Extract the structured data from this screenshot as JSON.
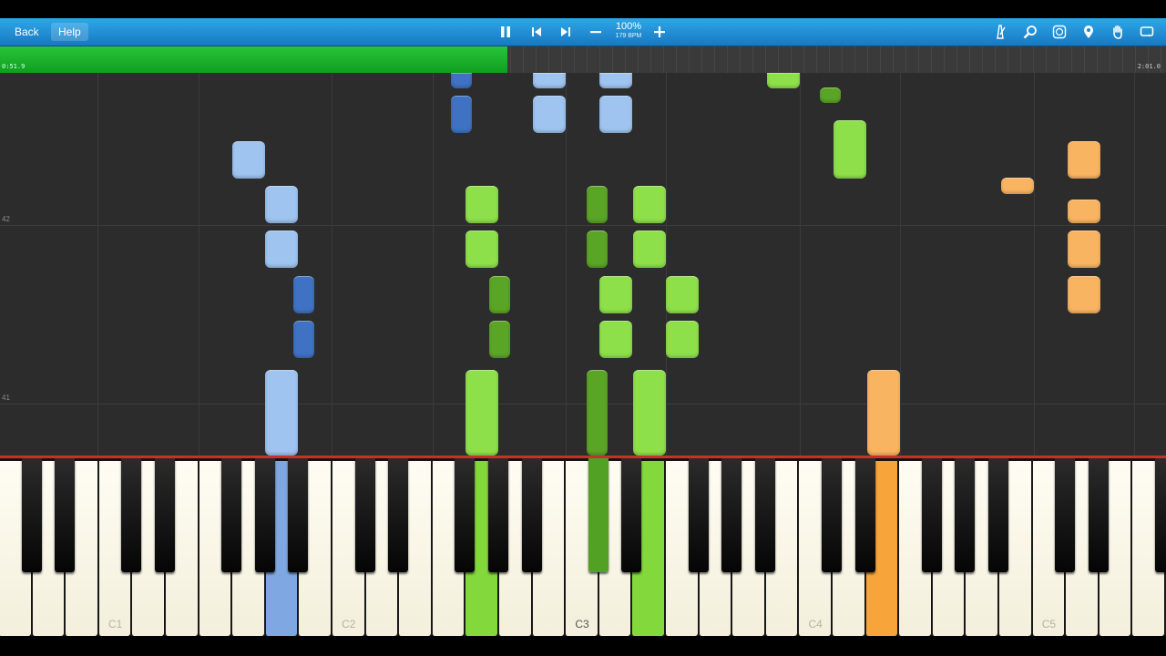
{
  "toolbar": {
    "back_label": "Back",
    "help_label": "Help",
    "zoom_value": "100%",
    "tempo_value": "179 BPM",
    "icons": [
      "pause-icon",
      "skip-back-icon",
      "skip-forward-icon",
      "zoom-out-icon",
      "zoom-in-icon",
      "metronome-icon",
      "search-icon",
      "note-labels-icon",
      "pin-icon",
      "hand-icon",
      "loop-icon"
    ]
  },
  "timeline": {
    "current_time": "0:51.9",
    "total_time": "2:01.0",
    "progress_fraction": 0.435,
    "progress_color": "#22b831"
  },
  "roll": {
    "measure_numbers": [
      "42",
      "41"
    ],
    "colors": {
      "light_blue": "#9ec4ef",
      "dark_blue": "#3f72c2",
      "light_green": "#8ee04a",
      "dark_green": "#5aa526",
      "orange": "#f9b461",
      "background": "#2c2c2c"
    }
  },
  "keyboard": {
    "octave_labels": [
      "C1",
      "C2",
      "C3",
      "C4",
      "C5"
    ],
    "pressed_colors": {
      "light_blue": "#7fa8e3",
      "light_green": "#83d83c",
      "dark_green": "#52a024",
      "orange": "#f7a43a"
    }
  }
}
